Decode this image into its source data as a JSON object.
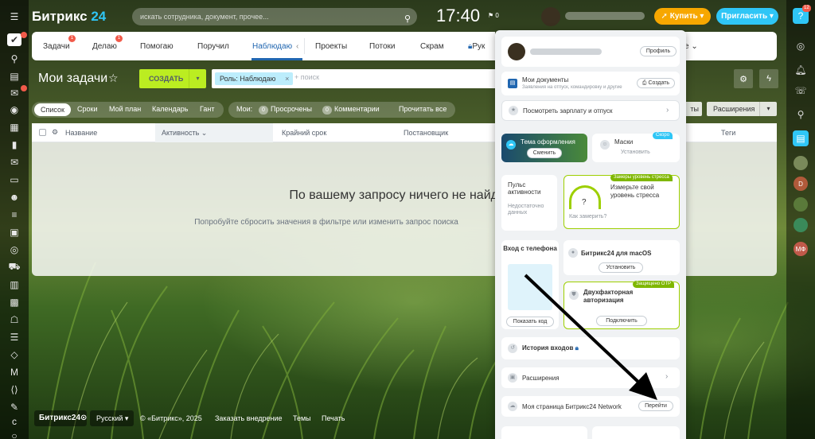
{
  "header": {
    "logo_main": "Битрикс",
    "logo_num": "24",
    "search_placeholder": "искать сотрудника, документ, прочее...",
    "time": "17:40",
    "time_badge": "0",
    "buy_label": "Купить",
    "invite_label": "Пригласить"
  },
  "nav": {
    "items": [
      "Задачи",
      "Делаю",
      "Помогаю",
      "Поручил",
      "Наблюдаю",
      "Проекты",
      "Потоки",
      "Скрам",
      "Рук",
      "е"
    ],
    "badges": [
      "1",
      "1"
    ]
  },
  "toolbar": {
    "title": "Мои задачи",
    "create_label": "СОЗДАТЬ",
    "filter_chip": "Роль: Наблюдаю",
    "filter_placeholder": "+ поиск"
  },
  "views": {
    "items": [
      "Список",
      "Сроки",
      "Мой план",
      "Календарь",
      "Гант"
    ],
    "counters_label": "Мои:",
    "overdue": {
      "count": "0",
      "label": "Просрочены"
    },
    "comments": {
      "count": "0",
      "label": "Комментарии"
    },
    "read_all": "Прочитать все",
    "edge_label": "ты",
    "extensions_label": "Расширения"
  },
  "table": {
    "columns": [
      "Название",
      "Активность",
      "Крайний срок",
      "Постановщик",
      "Теги"
    ],
    "empty_title": "По вашему запросу ничего не найдено",
    "empty_sub": "Попробуйте сбросить значения в фильтре или изменить запрос поиска"
  },
  "footer": {
    "logo": "Битрикс24",
    "lang": "Русский",
    "copyright": "© «Битрикс», 2025",
    "order": "Заказать внедрение",
    "themes": "Темы",
    "print": "Печать"
  },
  "popup": {
    "profile_btn": "Профиль",
    "docs_title": "Мои документы",
    "docs_sub": "Заявления на отпуск, командировку и другие",
    "docs_btn": "Создать",
    "salary": "Посмотреть зарплату и отпуск",
    "theme_title": "Тема оформления",
    "theme_btn": "Сменить",
    "masks_title": "Маски",
    "masks_btn": "Установить",
    "masks_badge": "Скоро",
    "pulse_title": "Пульс активности",
    "pulse_sub": "Недостаточно данных",
    "stress_badge": "Замеры уровень стресса",
    "stress_title": "Измерьте свой уровень стресса",
    "stress_link": "Как замерить?",
    "phone_title": "Вход с телефона",
    "phone_btn": "Показать код",
    "mac_title": "Битрикс24 для macOS",
    "mac_btn": "Установить",
    "otp_badge": "Защищено OTP",
    "otp_title": "Двухфакторная авторизация",
    "otp_btn": "Подключить",
    "history": "История входов",
    "extensions": "Расширения",
    "network": "Моя страница Битрикс24 Network",
    "network_btn": "Перейти"
  },
  "rightbar": {
    "top_badge": "12",
    "avatars": [
      "D",
      "МФ"
    ]
  }
}
